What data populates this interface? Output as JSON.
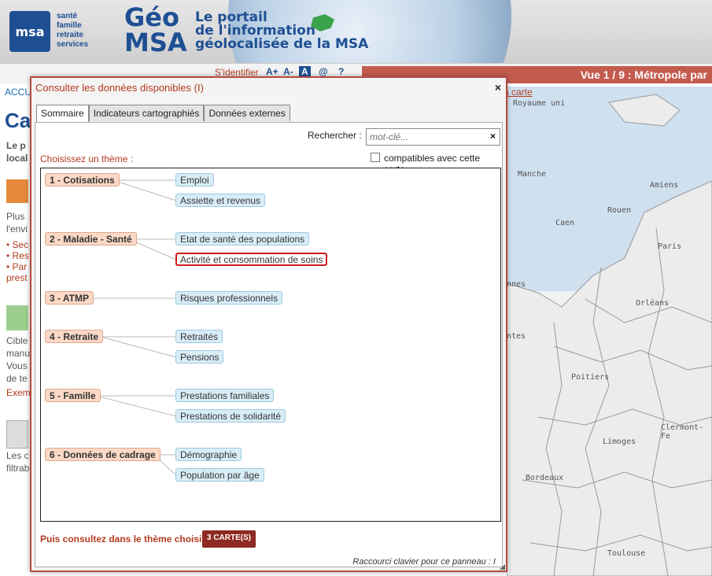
{
  "header": {
    "logo": "msa",
    "logo_words": [
      "santé",
      "famille",
      "retraite",
      "services"
    ],
    "title_line1": "Géo",
    "title_line2": "MSA",
    "tagline_line1": "Le portail",
    "tagline_line2": "de l'information",
    "tagline_line3": "géolocalisée de la MSA",
    "identify": "S'identifier",
    "tools": [
      "A+",
      "A-",
      "A",
      "@",
      "?"
    ],
    "view_label": "Vue 1 / 9 : Métropole par"
  },
  "background_page": {
    "accueil": "ACCU",
    "big_title": "Ca",
    "intro": [
      "Le p",
      "local"
    ],
    "para1": [
      "Plus",
      "l'envi",
      "• Sec",
      "• Res",
      "• Par",
      "prest"
    ],
    "para2": [
      "Cible",
      "manu",
      "Vous",
      "de te",
      "Exem"
    ],
    "para3": [
      "Les c",
      "filtrab"
    ]
  },
  "map": {
    "link": "a carte",
    "labels": [
      "Royaume uni",
      "Manche",
      "Amiens",
      "Rouen",
      "Caen",
      "Paris",
      "nnes",
      "Orléans",
      "ntes",
      "Poitiers",
      "Limoges",
      "Clermont-Fe",
      "Bordeaux",
      "Toulouse"
    ]
  },
  "dialog": {
    "title": "Consulter les données disponibles (I)",
    "close": "×",
    "tabs": [
      "Sommaire",
      "Indicateurs cartographiés",
      "Données externes"
    ],
    "search_label": "Rechercher :",
    "search_placeholder": "mot-clé...",
    "search_clear": "×",
    "choose_label": "Choisissez un thème :",
    "compat_label": "compatibles avec cette carte",
    "themes": [
      {
        "label": "1 - Cotisations",
        "subs": [
          "Emploi",
          "Assiette et revenus"
        ]
      },
      {
        "label": "2 - Maladie - Santé",
        "subs": [
          "Etat de santé des populations",
          "Activité et consommation de soins"
        ]
      },
      {
        "label": "3 - ATMP",
        "subs": [
          "Risques professionnels"
        ]
      },
      {
        "label": "4 - Retraite",
        "subs": [
          "Retraités",
          "Pensions"
        ]
      },
      {
        "label": "5 - Famille",
        "subs": [
          "Prestations familiales",
          "Prestations de solidarité"
        ]
      },
      {
        "label": "6 - Données de cadrage",
        "subs": [
          "Démographie",
          "Population par âge"
        ]
      }
    ],
    "selected_sub": "Activité et consommation de soins",
    "then_label": "Puis consultez dans le thème choisi :",
    "maps_button": "3 CARTE(S)",
    "shortcut": "Raccourci clavier pour ce panneau : I"
  },
  "colors": {
    "accent": "#b43a1f",
    "brand": "#1e4f93",
    "theme_bg": "#fbd9c6",
    "sub_bg": "#d9edf7",
    "selected_border": "#cc1b1b"
  }
}
